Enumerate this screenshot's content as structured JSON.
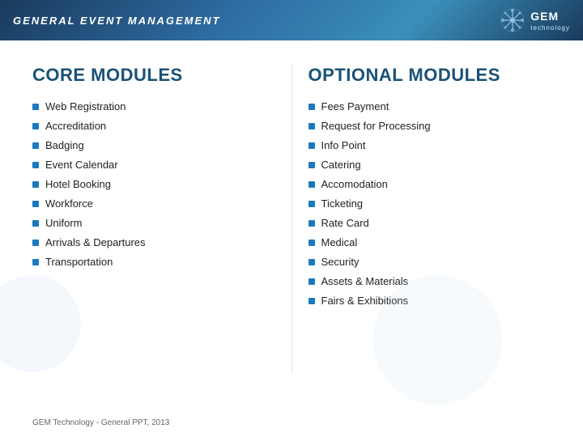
{
  "header": {
    "title": "General Event Management",
    "logo_text": "GEM",
    "logo_sub": "technology"
  },
  "core_modules": {
    "title": "CORE MODULES",
    "items": [
      "Web Registration",
      "Accreditation",
      "Badging",
      "Event Calendar",
      "Hotel Booking",
      "Workforce",
      "Uniform",
      "Arrivals & Departures",
      "Transportation"
    ]
  },
  "optional_modules": {
    "title": "OPTIONAL MODULES",
    "items": [
      "Fees Payment",
      "Request for Processing",
      "Info Point",
      "Catering",
      "Accomodation",
      "Ticketing",
      "Rate Card",
      "Medical",
      "Security",
      "Assets & Materials",
      "Fairs & Exhibitions"
    ]
  },
  "footer": {
    "text": "GEM Technology - General PPT, 2013"
  }
}
